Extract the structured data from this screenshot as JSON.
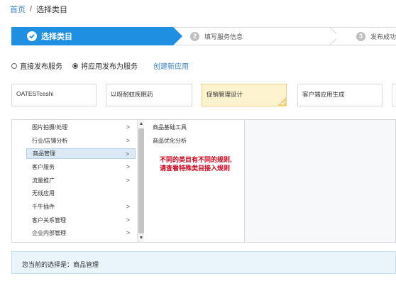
{
  "breadcrumb": {
    "home": "首页",
    "sep": "/",
    "current": "选择类目"
  },
  "steps": [
    {
      "label": "选择类目",
      "state": "active"
    },
    {
      "number": "2",
      "label": "填写服务信息"
    },
    {
      "number": "3",
      "label": "发布成功"
    }
  ],
  "publish_options": {
    "direct": "直接发布服务",
    "app": "将应用发布为服务",
    "selected": "app",
    "create_link": "创建新应用"
  },
  "apps": [
    {
      "name": "OATESTceshi"
    },
    {
      "name": "以呀耐蚊疾眠药"
    },
    {
      "name": "促销管理设计",
      "selected": true
    },
    {
      "name": "客户端应用生成"
    }
  ],
  "categories": [
    {
      "label": "图片拍摄/处理",
      "has_children": true
    },
    {
      "label": "行业/店铺分析",
      "has_children": true
    },
    {
      "label": "商品管理",
      "has_children": true,
      "active": true
    },
    {
      "label": "客户服务",
      "has_children": true
    },
    {
      "label": "流量推广",
      "has_children": true
    },
    {
      "label": "无线应用",
      "has_children": false
    },
    {
      "label": "千牛插件",
      "has_children": true
    },
    {
      "label": "客户关系管理",
      "has_children": true
    },
    {
      "label": "企业内部管理",
      "has_children": true
    }
  ],
  "subcategories": [
    {
      "label": "商品基础工具"
    },
    {
      "label": "商品优化分析"
    }
  ],
  "note": {
    "line1": "不同的类目有不同的规则,",
    "line2": "请查看特殊类目接入规则"
  },
  "current_selection": "您当前的选择是：商品管理",
  "colors": {
    "accent": "#1e8fe1",
    "link": "#3a82c4",
    "note": "#d0021b",
    "selected_card": "#fdf3cf",
    "selection_bar": "#e9f4fb"
  }
}
